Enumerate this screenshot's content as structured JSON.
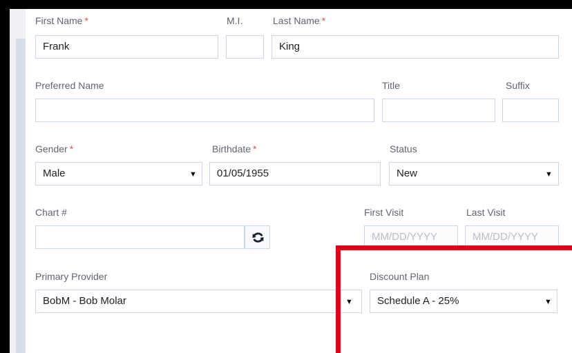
{
  "form": {
    "first_name": {
      "label": "First Name",
      "value": "Frank",
      "required_mark": "*"
    },
    "middle_initial": {
      "label": "M.I.",
      "value": ""
    },
    "last_name": {
      "label": "Last Name",
      "value": "King",
      "required_mark": "*"
    },
    "preferred_name": {
      "label": "Preferred Name",
      "value": ""
    },
    "title": {
      "label": "Title",
      "value": ""
    },
    "suffix": {
      "label": "Suffix",
      "value": ""
    },
    "gender": {
      "label": "Gender",
      "value": "Male",
      "required_mark": "*"
    },
    "birthdate": {
      "label": "Birthdate",
      "value": "01/05/1955",
      "required_mark": "*"
    },
    "status": {
      "label": "Status",
      "value": "New"
    },
    "chart_number": {
      "label": "Chart #",
      "value": ""
    },
    "first_visit": {
      "label": "First Visit",
      "placeholder": "MM/DD/YYYY"
    },
    "last_visit": {
      "label": "Last Visit",
      "placeholder": "MM/DD/YYYY"
    },
    "primary_provider": {
      "label": "Primary Provider",
      "value": "BobM - Bob Molar"
    },
    "discount_plan": {
      "label": "Discount Plan",
      "value": "Schedule A - 25%"
    }
  },
  "icons": {
    "sync": "sync-icon",
    "dropdown": "caret-down-icon"
  },
  "colors": {
    "required": "#d9534f",
    "field_border": "#c9d7e8",
    "highlight": "#e0001a"
  }
}
